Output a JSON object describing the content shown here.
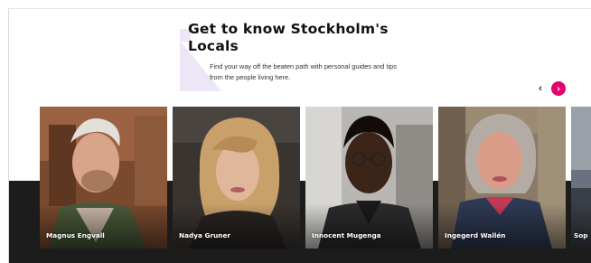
{
  "section": {
    "title": "Get to know Stockholm's Locals",
    "subtitle": "Find your way off the beaten path with personal guides and tips from the people living here."
  },
  "carousel": {
    "prev_icon": "chevron-left-icon",
    "next_icon": "chevron-right-icon",
    "prev_glyph": "‹",
    "next_glyph": "›",
    "accent_color": "#e5006e",
    "cards": [
      {
        "name": "Magnus Engvall"
      },
      {
        "name": "Nadya Gruner"
      },
      {
        "name": "Innocent Mugenga"
      },
      {
        "name": "Ingegerd Wallén"
      },
      {
        "name": "Sop"
      }
    ]
  }
}
